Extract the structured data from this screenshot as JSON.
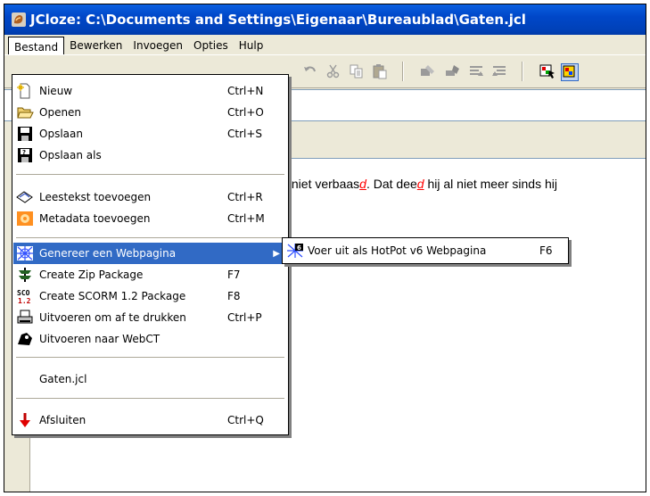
{
  "window": {
    "title": "JCloze: C:\\Documents and Settings\\Eigenaar\\Bureaublad\\Gaten.jcl"
  },
  "menubar": [
    {
      "label": "Bestand"
    },
    {
      "label": "Bewerken"
    },
    {
      "label": "Invoegen"
    },
    {
      "label": "Opties"
    },
    {
      "label": "Hulp"
    }
  ],
  "file_menu": {
    "items": [
      {
        "label": "Nieuw",
        "shortcut": "Ctrl+N",
        "icon": "new-file-icon"
      },
      {
        "label": "Openen",
        "shortcut": "Ctrl+O",
        "icon": "open-folder-icon"
      },
      {
        "label": "Opslaan",
        "shortcut": "Ctrl+S",
        "icon": "save-disk-icon"
      },
      {
        "label": "Opslaan als",
        "shortcut": "",
        "icon": "save-as-icon"
      },
      {
        "label": "Leestekst toevoegen",
        "shortcut": "Ctrl+R",
        "icon": "reading-text-icon"
      },
      {
        "label": "Metadata toevoegen",
        "shortcut": "Ctrl+M",
        "icon": "metadata-icon"
      },
      {
        "label": "Genereer een Webpagina",
        "shortcut": "",
        "icon": "web-icon"
      },
      {
        "label": "Create Zip Package",
        "shortcut": "F7",
        "icon": "zip-icon"
      },
      {
        "label": "Create SCORM 1.2 Package",
        "shortcut": "F8",
        "icon": "scorm-icon"
      },
      {
        "label": "Uitvoeren om af te drukken",
        "shortcut": "Ctrl+P",
        "icon": "print-icon"
      },
      {
        "label": "Uitvoeren naar WebCT",
        "shortcut": "",
        "icon": "webct-icon"
      },
      {
        "label": "Gaten.jcl",
        "shortcut": ""
      },
      {
        "label": "Afsluiten",
        "shortcut": "Ctrl+Q",
        "icon": "exit-icon"
      }
    ]
  },
  "submenu": {
    "label": "Voer uit als HotPot v6 Webpagina",
    "shortcut": "F6",
    "icon": "hotpot-v6-icon"
  },
  "body_text": {
    "part1": "k niet verbaas",
    "gap1": "d",
    "part2": ". Dat dee",
    "gap2": "d",
    "part3": " hij al niet meer sinds hij"
  },
  "colors": {
    "title_bar": "#0047c8",
    "highlight": "#316ac5",
    "gap_text": "#ff0000"
  }
}
